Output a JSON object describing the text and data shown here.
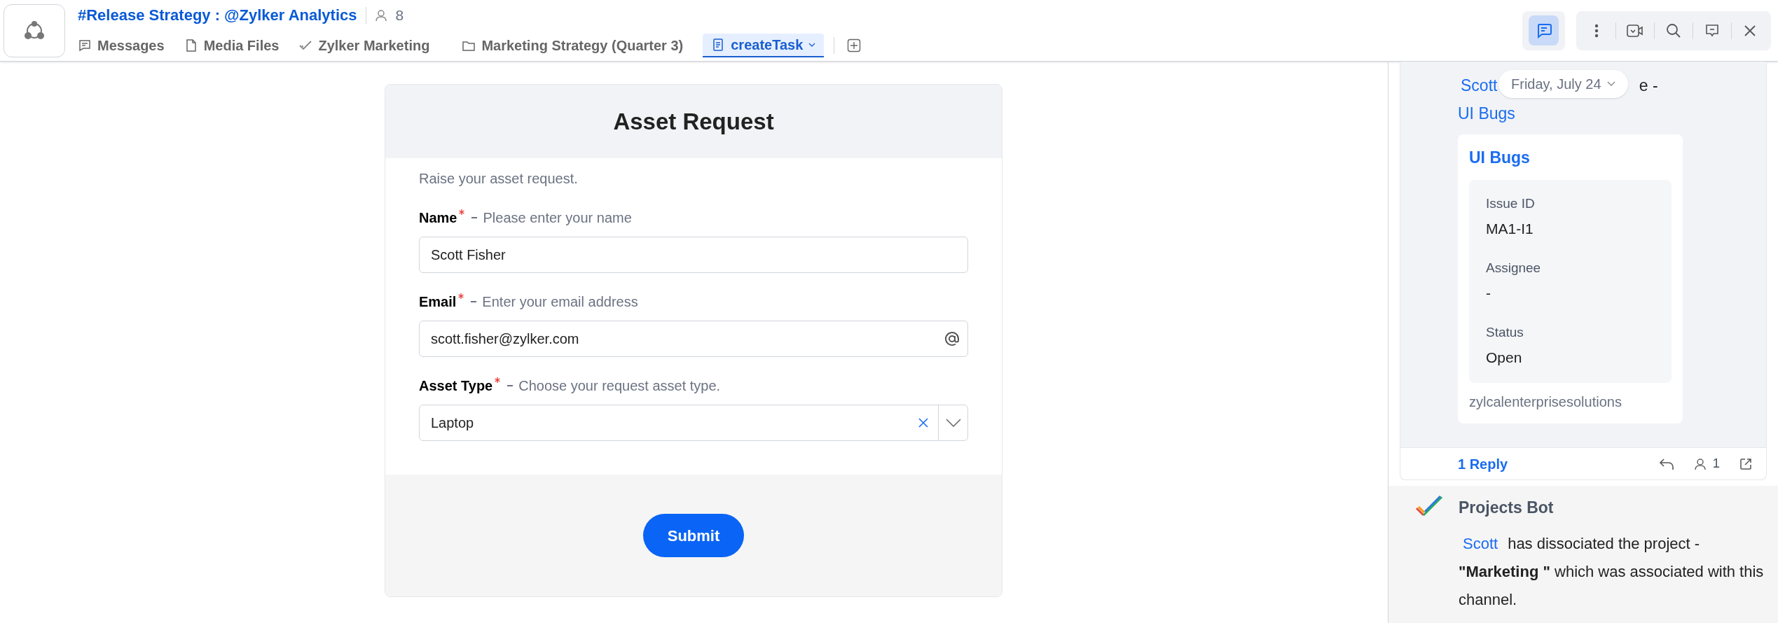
{
  "channel": {
    "title": "#Release Strategy : @Zylker Analytics",
    "member_count": "8"
  },
  "tabs": [
    {
      "kind": "messages",
      "label": "Messages",
      "selected": false
    },
    {
      "kind": "file",
      "label": "Media Files",
      "selected": false
    },
    {
      "kind": "check",
      "label": "Zylker Marketing",
      "selected": false
    },
    {
      "kind": "folder",
      "label": "Marketing Strategy (Quarter 3)",
      "selected": false
    },
    {
      "kind": "form",
      "label": "createTask",
      "selected": true
    }
  ],
  "toolbar": {
    "chat_panel_open": true
  },
  "form": {
    "title": "Asset Request",
    "description": "Raise your asset request.",
    "fields": [
      {
        "kind": "text",
        "label": "Name",
        "required": true,
        "hint": "Please enter your name",
        "value": "Scott Fisher"
      },
      {
        "kind": "email",
        "label": "Email",
        "required": true,
        "hint": "Enter your email address",
        "value": "scott.fisher@zylker.com"
      },
      {
        "kind": "select",
        "label": "Asset Type",
        "required": true,
        "hint": "Choose your request asset type.",
        "value": "Laptop"
      }
    ],
    "submit": "Submit"
  },
  "thread": {
    "date": "Friday, July 24",
    "mention": "Scott",
    "text_fragment": "e -",
    "link": "UI Bugs",
    "card": {
      "title": "UI Bugs",
      "fields": [
        {
          "label": "Issue ID",
          "value": "MA1-I1"
        },
        {
          "label": "Assignee",
          "value": "-"
        },
        {
          "label": "Status",
          "value": "Open"
        }
      ],
      "footer": "zylcalenterprisesolutions"
    },
    "replies": "1 Reply",
    "participants": "1"
  },
  "bot": {
    "name": "Projects Bot",
    "mention": "Scott",
    "text": "has dissociated the project - **\"Marketing \"** which was associated with this channel."
  }
}
